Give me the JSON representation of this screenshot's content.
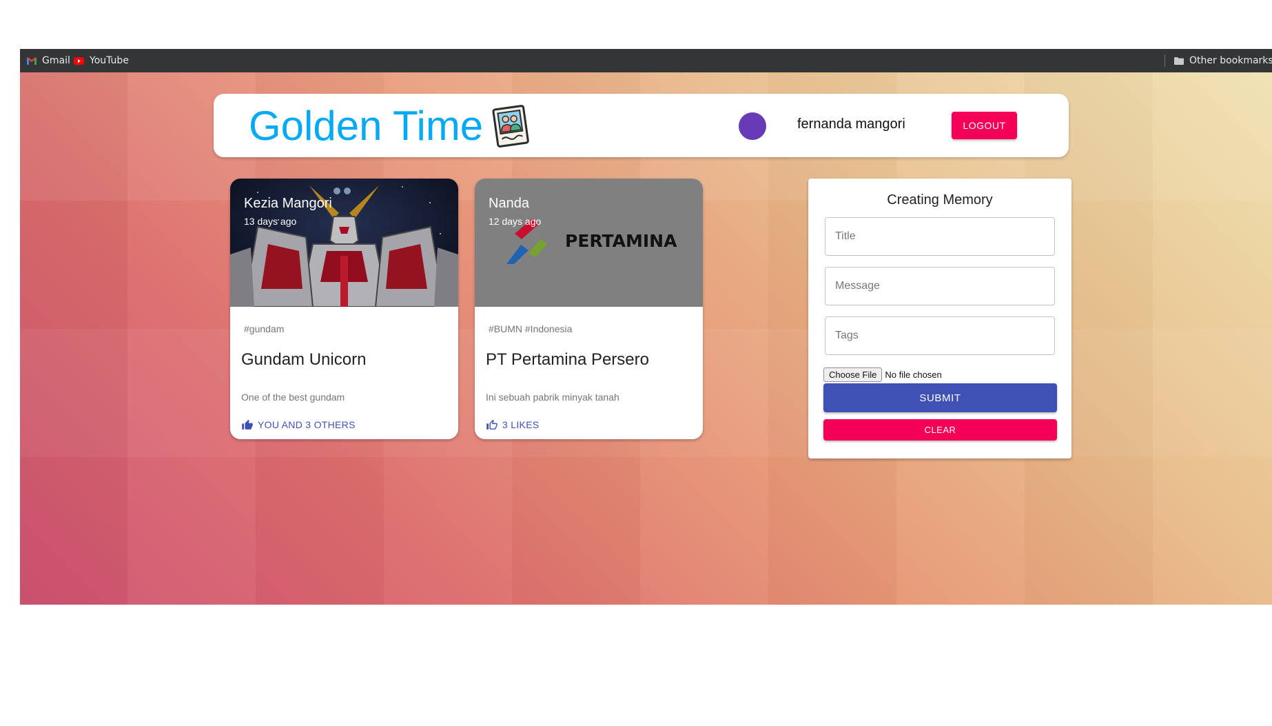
{
  "browser": {
    "bookmarks": [
      {
        "label": "Gmail",
        "icon": "gmail-icon"
      },
      {
        "label": "YouTube",
        "icon": "youtube-icon"
      }
    ],
    "other_bookmarks": {
      "label": "Other bookmarks",
      "icon": "folder-icon"
    }
  },
  "header": {
    "title": "Golden Time",
    "logo_icon": "memories-photo-icon",
    "user_name": "fernanda mangori",
    "avatar_color": "#673ab7",
    "logout_label": "LOGOUT"
  },
  "posts": [
    {
      "author": "Kezia Mangori",
      "time": "13 days ago",
      "tags": "#gundam",
      "title": "Gundam Unicorn",
      "message": "One of the best gundam",
      "likes": "YOU AND 3 OTHERS",
      "liked": true
    },
    {
      "author": "Nanda",
      "time": "12 days ago",
      "tags": "#BUMN #Indonesia",
      "title": "PT Pertamina Persero",
      "message": "Ini sebuah pabrik minyak tanah",
      "likes": "3 LIKES",
      "liked": false,
      "image_text": "PERTAMINA"
    }
  ],
  "form": {
    "heading": "Creating Memory",
    "title_placeholder": "Title",
    "message_placeholder": "Message",
    "tags_placeholder": "Tags",
    "file_button": "Choose File",
    "file_status": "No file chosen",
    "submit_label": "SUBMIT",
    "clear_label": "CLEAR"
  },
  "colors": {
    "brand": "#05a9f4",
    "primary": "#3f51b5",
    "secondary": "#f50057"
  }
}
